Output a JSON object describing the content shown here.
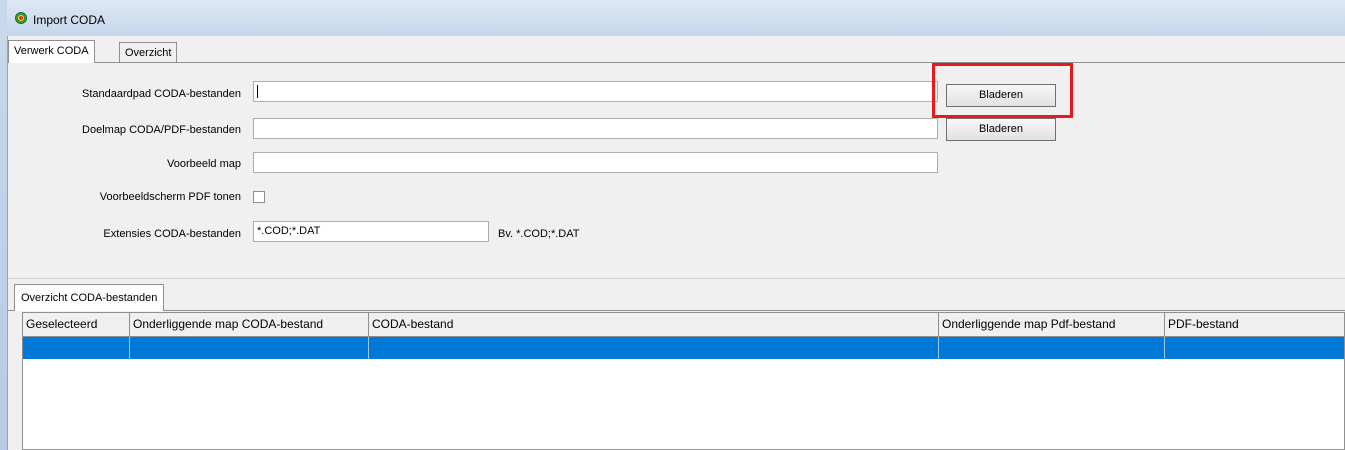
{
  "window": {
    "title": "Import CODA"
  },
  "tabs": [
    {
      "label": "Verwerk CODA",
      "active": true
    },
    {
      "label": "Overzicht",
      "active": false
    }
  ],
  "form": {
    "standaardpad": {
      "label": "Standaardpad CODA-bestanden",
      "value": "",
      "button": "Bladeren"
    },
    "doelmap": {
      "label": "Doelmap CODA/PDF-bestanden",
      "value": "",
      "button": "Bladeren"
    },
    "voorbeeld_map": {
      "label": "Voorbeeld map",
      "value": ""
    },
    "voorbeeldscherm": {
      "label": "Voorbeeldscherm PDF tonen",
      "checked": false
    },
    "extensies": {
      "label": "Extensies CODA-bestanden",
      "value": "*.COD;*.DAT",
      "hint": "Bv. *.COD;*.DAT"
    }
  },
  "overview": {
    "tab_label": "Overzicht CODA-bestanden",
    "columns": [
      "Geselecteerd",
      "Onderliggende map CODA-bestand",
      "CODA-bestand",
      "Onderliggende map Pdf-bestand",
      "PDF-bestand"
    ],
    "rows": [
      [
        "",
        "",
        "",
        "",
        ""
      ]
    ],
    "selection_color": "#0078d7"
  },
  "highlight_color": "#e5191e"
}
